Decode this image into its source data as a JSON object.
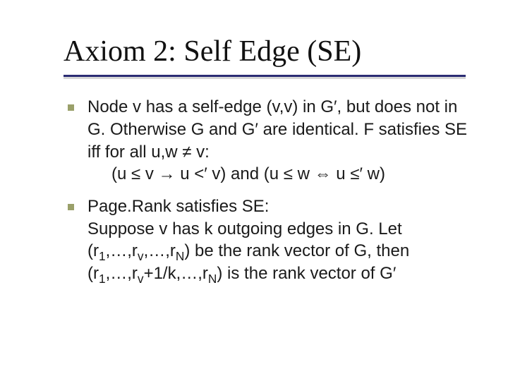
{
  "title": "Axiom 2: Self Edge (SE)",
  "bullets": [
    {
      "l1": "Node v has a self-edge (v,v) in G′, but does not in G. Otherwise G and G′ are identical. F satisfies SE iff for all u,w ≠ v:",
      "l2_pre": "(u ",
      "l2_le": "≤",
      "l2_mid1": " v ",
      "l2_arrow": "→",
      "l2_mid2": " u <′ v) and (u ",
      "l2_le2": "≤",
      "l2_mid3": " w ",
      "l2_iff": "⇔",
      "l2_mid4": " u ",
      "l2_le3": "≤",
      "l2_end": "′ w)"
    },
    {
      "l1": "Page.Rank satisfies SE:",
      "l2": "Suppose v has k outgoing edges in G. Let",
      "r_open": "(r",
      "sub1": "1",
      "r_mid1": ",…,r",
      "subv": "v",
      "r_mid2": ",…,r",
      "subn": "N",
      "r_close": ") be the rank vector of G, then",
      "r2_open": "(r",
      "r2_sub1": "1",
      "r2_mid1": ",…,r",
      "r2_subv": "v",
      "r2_plus": "+1/k,…,r",
      "r2_subn": "N",
      "r2_close": ") is the rank vector of G′"
    }
  ]
}
